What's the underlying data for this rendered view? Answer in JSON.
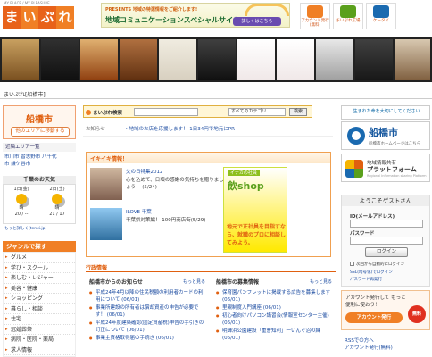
{
  "header": {
    "tagline": "MY PLACE / MY PLEASURE",
    "logo_chars": [
      "ま",
      "い",
      "ぷ",
      "れ"
    ],
    "banner_line1": "PRESENTS 地域の特選情報をご紹介します!",
    "banner_title": "地域コミュニケーションスペシャルサイト",
    "banner_button": "詳しくはこちら",
    "icons": [
      {
        "name": "account-icon",
        "label": "アカウント発行(無料)",
        "color": "#f07f25"
      },
      {
        "name": "shop-icon",
        "label": "まいぷれ広場",
        "color": "#5aa01c"
      },
      {
        "name": "mobile-icon",
        "label": "ケータイ",
        "color": "#1a6ab0"
      }
    ]
  },
  "breadcrumb": "まいぷれ[船橋市]",
  "left": {
    "city": "船橋市",
    "city_button": "他のエリアに移動する",
    "nearby_header": "近隣エリア一覧",
    "nearby_line1": "市川市 習志野市 八千代",
    "nearby_line2": "市 鎌ケ谷市",
    "weather_header": "千葉のお天気",
    "weather": [
      {
        "day": "1日(金)",
        "cond": "晴",
        "temp": "20 / --"
      },
      {
        "day": "2日(土)",
        "cond": "晴",
        "temp": "21 / 17"
      }
    ],
    "weather_link": "もっと詳しく(tenki.jp)",
    "genre_header": "ジャンルで探す",
    "genres": [
      "グルメ",
      "学び・スクール",
      "楽しむ・レジャー",
      "美容・健康",
      "ショッピング",
      "暮らし・相談",
      "住宅",
      "冠婚葬祭",
      "病院・医院・薬局",
      "求人情報"
    ]
  },
  "center": {
    "search_label": "まいぷれ検索",
    "search_placeholder": "",
    "category": "すべてのカテゴリ",
    "search_button": "検索",
    "notice_label": "お知らせ",
    "notice_text": "・地域のお店を応援します！ 1日34円で地元にPR",
    "ikiiki_header": "イキイキ情報！",
    "ikiiki": [
      {
        "title": "父の日特集2012",
        "text": "心を込めて、日頃の感謝の気持ちを贈りましょう！ (5/24)"
      },
      {
        "title": "ILOVE 千葉",
        "text": "千葉県対策編！ 100円商店街(5/29)"
      }
    ],
    "ad_badge": "イナカの社員",
    "ad_shop": "飲shop",
    "ad_text": "地元で正社員を目指すなら、就職のプロに相談してみよう。",
    "gyosei_header": "行政情報",
    "col1_header": "船橋市からのお知らせ",
    "col2_header": "船橋市の募集情報",
    "more": "もっと見る",
    "col1_items": [
      "平成24年4月以降の住民税額の利用者カードの利用について (06/01)",
      "事業所建設の所有者は償却資産の申告が必要です！ (06/01)",
      "平成24年度建築確認(固定資産税)申告の手引きの訂正について (06/01)",
      "事業主資格取得届の手続き (06/01)"
    ],
    "col2_items": [
      "保育園パンフレットに掲載する広告を募集します (06/01)",
      "里親制度入門講座 (06/01)",
      "初心者向けパソコン講習会(情報室センター主催) (06/01)",
      "明輝浜公園建設「重曹知利」一いんぐ沼の練 (06/01)"
    ]
  },
  "right": {
    "banner_line1": "生まれた命を大切にしてください",
    "banner_line2": "",
    "fun_name": "船橋市",
    "fun_sub": "船橋市ホームページはこちら",
    "plat_line1": "地域情報共有",
    "plat_line2": "プラットフォーム",
    "plat_line3": "Regional Information sharing Platform",
    "welcome": "ようこそゲストさん",
    "id_label": "ID(メールアドレス)",
    "pw_label": "パスワード",
    "login_button": "ログイン",
    "auto_login": "次回から自動的にログイン",
    "ssl_link": "SSL(暗号化)でログイン",
    "forgot_link": "パスワード再発行",
    "reg_text": "アカウント発行して もっと便利に使おう！",
    "reg_button": "アカウント発行",
    "reg_badge": "無料",
    "links": [
      "RSSでの方へ",
      "アカウント発行(無料)"
    ]
  }
}
